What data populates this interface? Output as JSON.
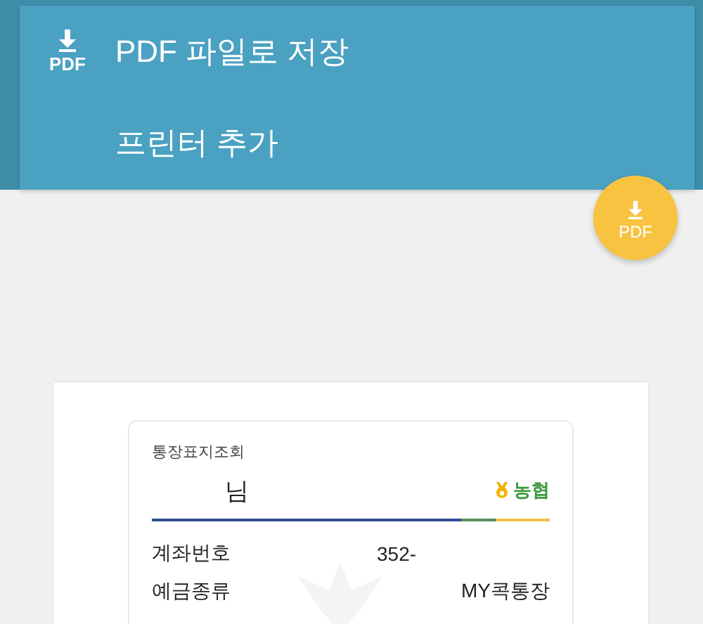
{
  "menu": {
    "items": [
      {
        "label": "PDF 파일로 저장",
        "kind": "pdf",
        "icon_label": "PDF"
      },
      {
        "label": "프린터 추가",
        "kind": "plain"
      }
    ]
  },
  "fab": {
    "label": "PDF"
  },
  "document": {
    "title": "통장표지조회",
    "holder": "님",
    "bank": "농협",
    "rows": [
      {
        "label": "계좌번호",
        "value": "352-",
        "kind": "number"
      },
      {
        "label": "예금종류",
        "value": "MY콕통장",
        "kind": "text"
      }
    ]
  }
}
